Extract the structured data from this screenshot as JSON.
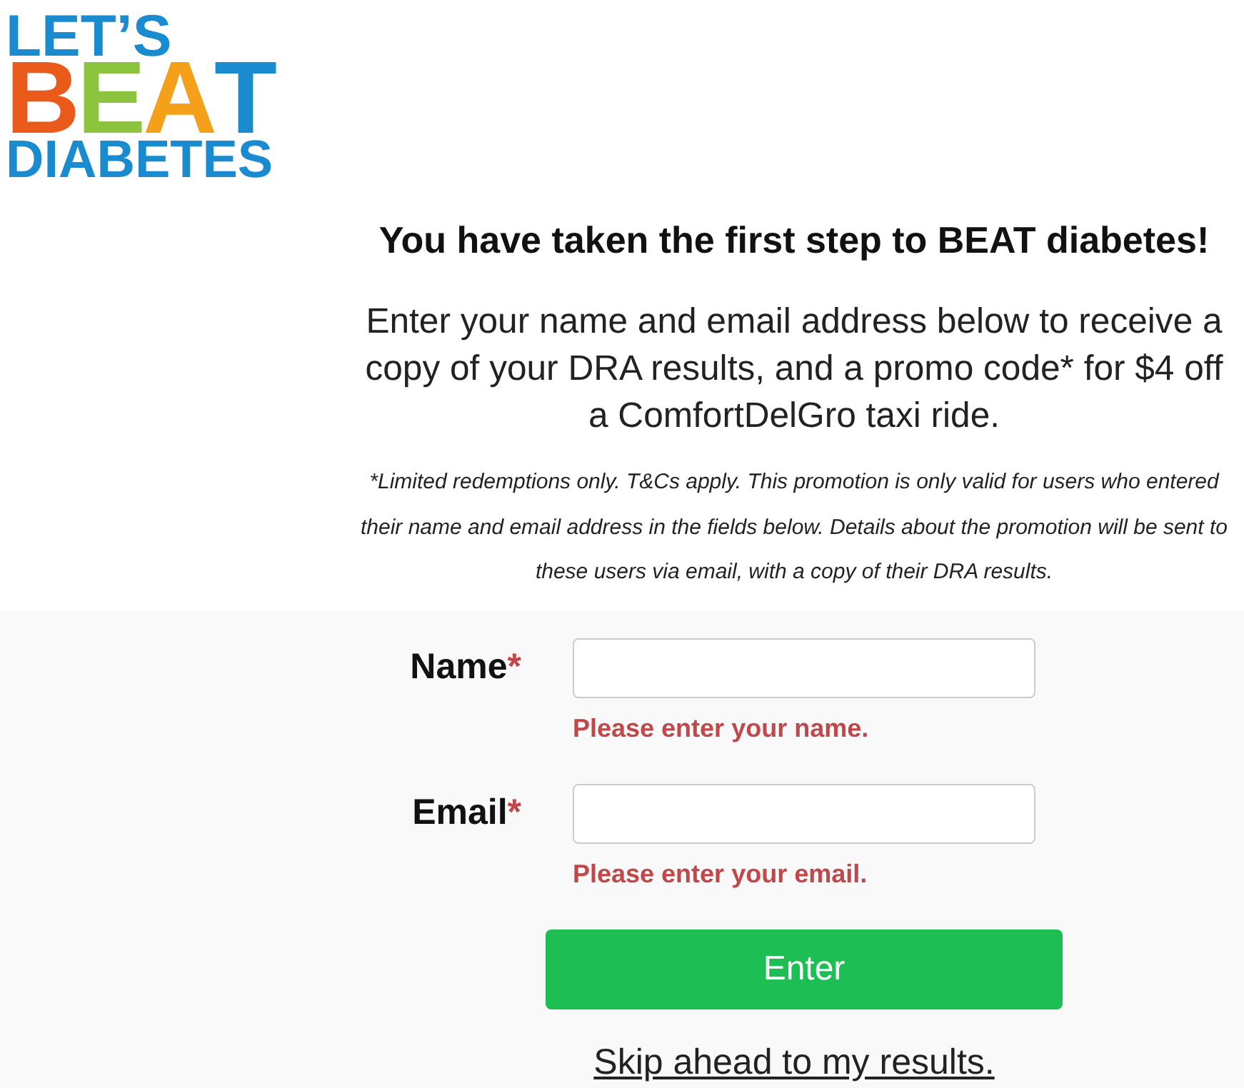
{
  "logo": {
    "line_1": "LET’S",
    "line_2": "BEAT",
    "line_3": "DIABETES"
  },
  "heading": "You have taken the first step to BEAT diabetes!",
  "intro": "Enter your name and email address below to receive a copy of your DRA results, and a promo code* for $4 off a ComfortDelGro taxi ride.",
  "fine_print": "*Limited redemptions only. T&Cs apply. This promotion is only valid for users who entered their name and email address in the fields below. Details about the promotion will be sent to these users via email, with a copy of their DRA results.",
  "form": {
    "fields": [
      {
        "label": "Name",
        "required_mark": "*",
        "error": "Please enter your name."
      },
      {
        "label": "Email",
        "required_mark": "*",
        "error": "Please enter your email."
      }
    ],
    "submit_button": {
      "label": "Enter"
    },
    "skip_link": {
      "label": "Skip ahead to my results."
    }
  }
}
